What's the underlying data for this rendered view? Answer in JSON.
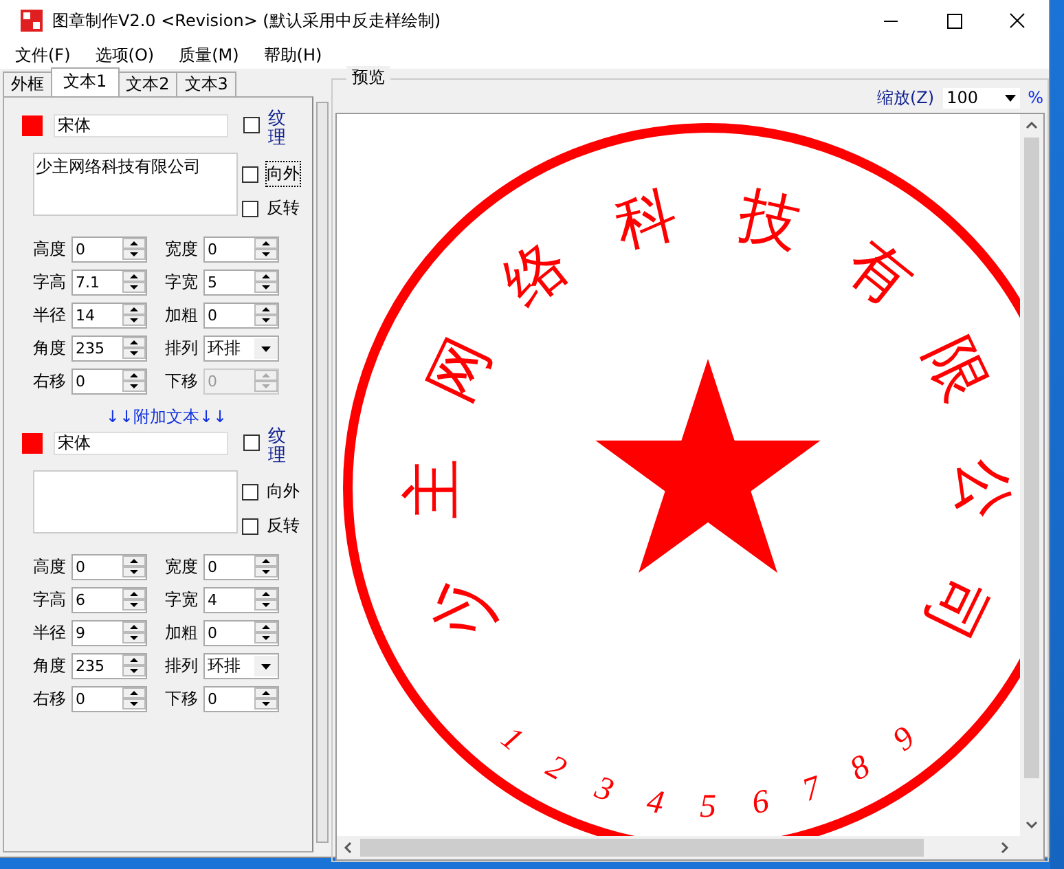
{
  "window": {
    "title": "图章制作V2.0 <Revision> (默认采用中反走样绘制)"
  },
  "menu": [
    "文件(F)",
    "选项(O)",
    "质量(M)",
    "帮助(H)"
  ],
  "tabs": [
    {
      "label": "外框",
      "selected": false
    },
    {
      "label": "文本1",
      "selected": true
    },
    {
      "label": "文本2",
      "selected": false
    },
    {
      "label": "文本3",
      "selected": false
    }
  ],
  "sections": [
    {
      "color": "#ff0000",
      "font": "宋体",
      "texture": {
        "label": "纹理",
        "checked": false
      },
      "text": "少主网络科技有限公司",
      "outward": {
        "label": "向外",
        "checked": false
      },
      "reverse": {
        "label": "反转",
        "checked": false
      },
      "fields": [
        {
          "label": "高度",
          "value": "0",
          "kind": "spin",
          "disabled": false
        },
        {
          "label": "宽度",
          "value": "0",
          "kind": "spin",
          "disabled": false
        },
        {
          "label": "字高",
          "value": "7.1",
          "kind": "spin",
          "disabled": false
        },
        {
          "label": "字宽",
          "value": "5",
          "kind": "spin",
          "disabled": false
        },
        {
          "label": "半径",
          "value": "14",
          "kind": "spin",
          "disabled": false
        },
        {
          "label": "加粗",
          "value": "0",
          "kind": "spin",
          "disabled": false
        },
        {
          "label": "角度",
          "value": "235",
          "kind": "spin",
          "disabled": false
        },
        {
          "label": "排列",
          "value": "环排",
          "kind": "select"
        },
        {
          "label": "右移",
          "value": "0",
          "kind": "spin",
          "disabled": false
        },
        {
          "label": "下移",
          "value": "0",
          "kind": "spin",
          "disabled": true
        }
      ]
    },
    {
      "heading": "↓↓附加文本↓↓",
      "color": "#ff0000",
      "font": "宋体",
      "texture": {
        "label": "纹理",
        "checked": false
      },
      "outward": {
        "label": "向外",
        "checked": false
      },
      "reverse": {
        "label": "反转",
        "checked": false
      },
      "fields": [
        {
          "label": "高度",
          "value": "0",
          "kind": "spin",
          "disabled": false
        },
        {
          "label": "宽度",
          "value": "0",
          "kind": "spin",
          "disabled": false
        },
        {
          "label": "字高",
          "value": "6",
          "kind": "spin",
          "disabled": false
        },
        {
          "label": "字宽",
          "value": "4",
          "kind": "spin",
          "disabled": false
        },
        {
          "label": "半径",
          "value": "9",
          "kind": "spin",
          "disabled": false
        },
        {
          "label": "加粗",
          "value": "0",
          "kind": "spin",
          "disabled": false
        },
        {
          "label": "角度",
          "value": "235",
          "kind": "spin",
          "disabled": false
        },
        {
          "label": "排列",
          "value": "环排",
          "kind": "select"
        },
        {
          "label": "右移",
          "value": "0",
          "kind": "spin",
          "disabled": false
        },
        {
          "label": "下移",
          "value": "0",
          "kind": "spin",
          "disabled": false
        }
      ]
    }
  ],
  "preview": {
    "label": "预览",
    "zoom_label": "缩放(Z)",
    "zoom_value": "100",
    "percent": "%",
    "stamp": {
      "color": "#ff0000",
      "main_text": "少主网络科技有限公司",
      "bottom_characters": [
        "1",
        "2",
        "3",
        "4",
        "5",
        "6",
        "7",
        "8",
        "9"
      ]
    }
  }
}
